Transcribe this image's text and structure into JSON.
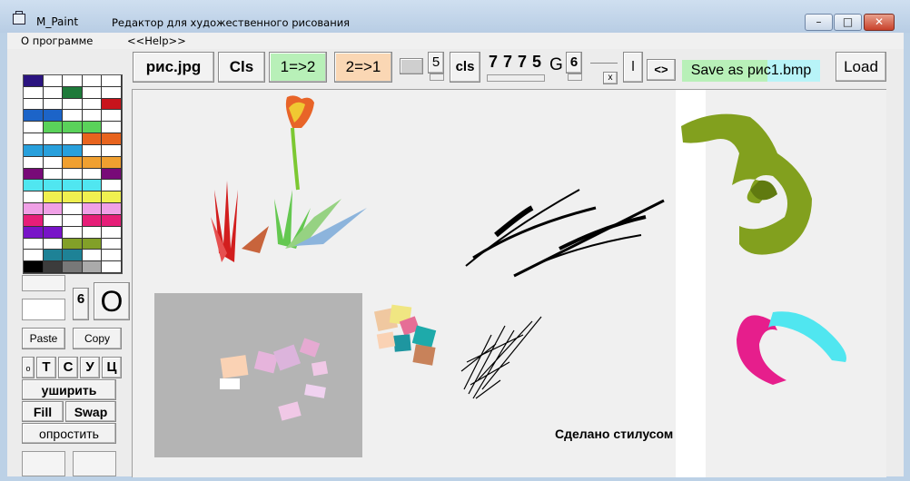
{
  "titlebar": {
    "app_name": "M_Paint",
    "description": "Редактор для художественного рисования",
    "min": "–",
    "max": "□",
    "close": "✕"
  },
  "menu": {
    "about": "О программе",
    "help": "<<Help>>"
  },
  "toolbar": {
    "open_jpg": "рис.jpg",
    "cls_big": "Cls",
    "copy_1_2": "1=>2",
    "copy_2_1": "2=>1",
    "width_value": "5",
    "cls_small": "cls",
    "d1": "7",
    "d2": "7",
    "d3": "7",
    "d4": "5",
    "g_label": "G",
    "g_value": "6",
    "x_label": "x",
    "pipe": "l",
    "swap_arrows": "<>",
    "save_as": "Save as рис1.bmp",
    "load": "Load"
  },
  "left_panel": {
    "size_value": "6",
    "shape_o": "O",
    "paste": "Paste",
    "copy": "Copy",
    "mode_small_o": "o",
    "mode_t": "Т",
    "mode_s": "С",
    "mode_u": "У",
    "mode_ts": "Ц",
    "widen": "уширить",
    "fill": "Fill",
    "swap": "Swap",
    "simplify": "опростить"
  },
  "canvas": {
    "caption": "Сделано стилусом"
  },
  "palette_colors": [
    "#2b1480",
    "#ffffff",
    "#ffffff",
    "#ffffff",
    "#ffffff",
    "#ffffff",
    "#ffffff",
    "#1e7a3a",
    "#ffffff",
    "#ffffff",
    "#ffffff",
    "#ffffff",
    "#ffffff",
    "#ffffff",
    "#c8141c",
    "#1c64c8",
    "#1c64c8",
    "#ffffff",
    "#ffffff",
    "#ffffff",
    "#ffffff",
    "#5ad25a",
    "#5ad25a",
    "#5ad25a",
    "#ffffff",
    "#ffffff",
    "#ffffff",
    "#ffffff",
    "#e8641e",
    "#e8641e",
    "#28a0dc",
    "#28a0dc",
    "#28a0dc",
    "#ffffff",
    "#ffffff",
    "#ffffff",
    "#ffffff",
    "#f0a030",
    "#f0a030",
    "#f0a030",
    "#780a78",
    "#ffffff",
    "#ffffff",
    "#ffffff",
    "#780a78",
    "#50e6f0",
    "#50e6f0",
    "#50e6f0",
    "#50e6f0",
    "#ffffff",
    "#ffffff",
    "#f0f050",
    "#f0f050",
    "#f0f050",
    "#f0f050",
    "#f0a0e6",
    "#f0a0e6",
    "#ffffff",
    "#f0a0e6",
    "#f0a0e6",
    "#e61e78",
    "#ffffff",
    "#ffffff",
    "#e61e78",
    "#e61e78",
    "#7814c8",
    "#7814c8",
    "#ffffff",
    "#ffffff",
    "#ffffff",
    "#ffffff",
    "#ffffff",
    "#82a028",
    "#82a028",
    "#ffffff",
    "#ffffff",
    "#1e8296",
    "#1e8296",
    "#ffffff",
    "#ffffff",
    "#000000",
    "#3c3c3c",
    "#787878",
    "#aaaaaa",
    "#ffffff"
  ]
}
